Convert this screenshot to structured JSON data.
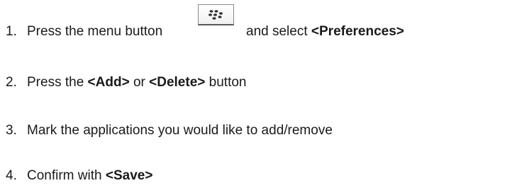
{
  "steps": [
    {
      "number": "1.",
      "text_before": "Press the menu button",
      "text_after": "and select",
      "bold": "<Preferences>"
    },
    {
      "number": "2.",
      "text_before": "Press the",
      "bold_1": "<Add>",
      "text_middle": "or",
      "bold_2": "<Delete>",
      "text_after": "button"
    },
    {
      "number": "3.",
      "text": "Mark the applications you would like to add/remove"
    },
    {
      "number": "4.",
      "text_before": "Confirm with",
      "bold": "<Save>"
    }
  ],
  "icons": {
    "menu_key": "blackberry-menu-key-icon"
  }
}
